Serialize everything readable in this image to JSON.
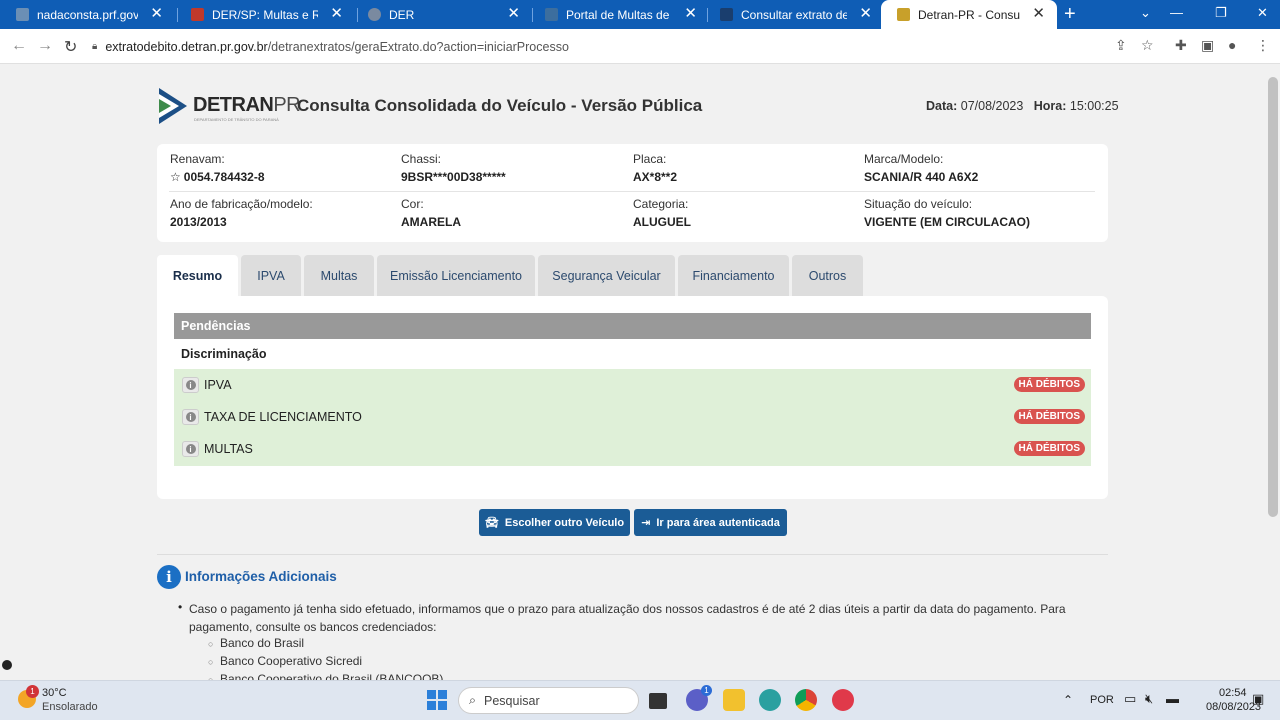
{
  "browser": {
    "tabs": [
      {
        "title": "nadaconsta.prf.gov.br/nada",
        "favicon_color": "#6b8fb5"
      },
      {
        "title": "DER/SP: Multas e Recursos",
        "favicon_color": "#c0392b"
      },
      {
        "title": "DER",
        "favicon_color": "#7a8aa0"
      },
      {
        "title": "Portal de Multas de Trânsit",
        "favicon_color": "#3c6e9e"
      },
      {
        "title": "Consultar extrato de veícul",
        "favicon_color": "#1a3e6e"
      },
      {
        "title": "Detran-PR - Consulta Cons",
        "favicon_color": "#c8a02a"
      }
    ],
    "url_host": "extratodebito.detran.pr.gov.br",
    "url_path": "/detranextratos/geraExtrato.do?action=iniciarProcesso"
  },
  "header": {
    "logo_brand": "DETRAN",
    "logo_state": "PR",
    "logo_sub": "DEPARTAMENTO DE TRÂNSITO DO PARANÁ",
    "title": "Consulta Consolidada do Veículo - Versão Pública",
    "date_label": "Data:",
    "date_value": "07/08/2023",
    "time_label": "Hora:",
    "time_value": "15:00:25"
  },
  "vehicle": {
    "renavam_label": "Renavam:",
    "renavam_value": "0054.784432-8",
    "chassi_label": "Chassi:",
    "chassi_value": "9BSR***00D38*****",
    "placa_label": "Placa:",
    "placa_value": "AX*8**2",
    "marca_label": "Marca/Modelo:",
    "marca_value": "SCANIA/R 440 A6X2",
    "ano_label": "Ano de fabricação/modelo:",
    "ano_value": "2013/2013",
    "cor_label": "Cor:",
    "cor_value": "AMARELA",
    "categoria_label": "Categoria:",
    "categoria_value": "ALUGUEL",
    "situacao_label": "Situação do veículo:",
    "situacao_value": "VIGENTE (EM CIRCULACAO)"
  },
  "tabs": [
    "Resumo",
    "IPVA",
    "Multas",
    "Emissão Licenciamento",
    "Segurança Veicular",
    "Financiamento",
    "Outros"
  ],
  "pendencias": {
    "header": "Pendências",
    "subheader": "Discriminação",
    "items": [
      {
        "label": "IPVA",
        "status": "HÁ DÉBITOS"
      },
      {
        "label": "TAXA DE LICENCIAMENTO",
        "status": "HÁ DÉBITOS"
      },
      {
        "label": "MULTAS",
        "status": "HÁ DÉBITOS"
      }
    ]
  },
  "actions": {
    "choose_other": "Escolher outro Veículo",
    "authenticated": "Ir para área autenticada"
  },
  "info": {
    "title": "Informações Adicionais",
    "text": "Caso o pagamento já tenha sido efetuado, informamos que o prazo para atualização dos nossos cadastros é de até 2 dias úteis a partir da data do pagamento. Para pagamento, consulte os bancos credenciados:",
    "banks": [
      "Banco do Brasil",
      "Banco Cooperativo Sicredi",
      "Banco Cooperativo do Brasil (BANCOOB)"
    ]
  },
  "taskbar": {
    "temp": "30°C",
    "weather": "Ensolarado",
    "weather_badge": "1",
    "search_placeholder": "Pesquisar",
    "chat_badge": "1",
    "lang": "POR",
    "time": "02:54",
    "date": "08/08/2023"
  }
}
